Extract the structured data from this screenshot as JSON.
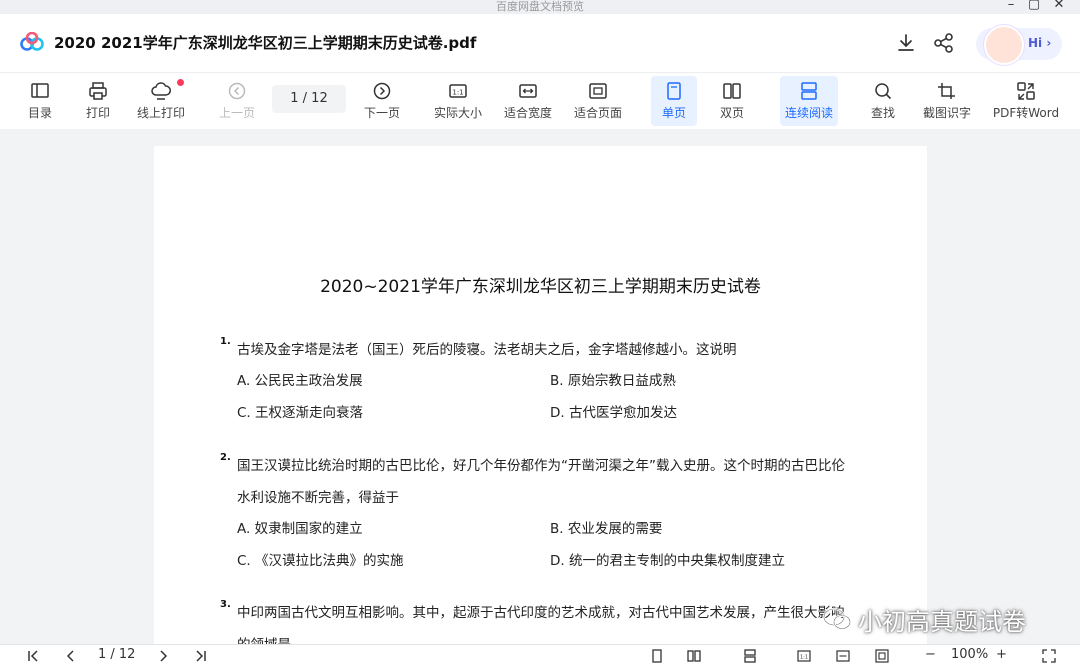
{
  "window": {
    "title": "百度网盘文档预览"
  },
  "header": {
    "doc_title": "2020  2021学年广东深圳龙华区初三上学期期末历史试卷.pdf",
    "hi_label": "Hi ›"
  },
  "toolbar": {
    "toc": "目录",
    "print": "打印",
    "online_print": "线上打印",
    "prev": "上一页",
    "page_indicator": "1  /  12",
    "next": "下一页",
    "actual_size": "实际大小",
    "fit_width": "适合宽度",
    "fit_page": "适合页面",
    "single": "单页",
    "double": "双页",
    "continuous": "连续阅读",
    "find": "查找",
    "ocr": "截图识字",
    "pdf2word": "PDF转Word"
  },
  "doc": {
    "title": "2020~2021学年广东深圳龙华区初三上学期期末历史试卷",
    "questions": [
      {
        "num": "1.",
        "lines": [
          "古埃及金字塔是法老（国王）死后的陵寝。法老胡夫之后，金字塔越修越小。这说明"
        ],
        "options": [
          "A. 公民民主政治发展",
          "B. 原始宗教日益成熟",
          "C. 王权逐渐走向衰落",
          "D. 古代医学愈加发达"
        ]
      },
      {
        "num": "2.",
        "lines": [
          "国王汉谟拉比统治时期的古巴比伦，好几个年份都作为“开凿河渠之年”载入史册。这个时期的古巴比伦",
          "水利设施不断完善，得益于"
        ],
        "options": [
          "A. 奴隶制国家的建立",
          "B. 农业发展的需要",
          "C. 《汉谟拉比法典》的实施",
          "D. 统一的君主专制的中央集权制度建立"
        ]
      },
      {
        "num": "3.",
        "lines": [
          "中印两国古代文明互相影响。其中，起源于古代印度的艺术成就，对古代中国艺术发展，产生很大影响",
          "的领域是"
        ]
      }
    ]
  },
  "watermark": "小初高真题试卷",
  "statusbar": {
    "page": "1  / 12",
    "zoom": "100%",
    "minus": "−",
    "plus": "+"
  },
  "colors": {
    "accent": "#1f6bff",
    "active_bg": "#e7f1ff",
    "notify": "#ff3b5c"
  }
}
